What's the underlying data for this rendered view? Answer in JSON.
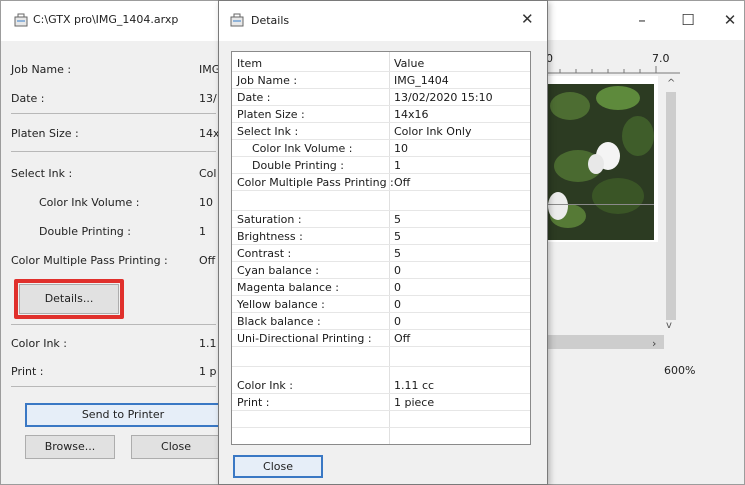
{
  "main_window": {
    "title": "C:\\GTX pro\\IMG_1404.arxp",
    "controls": {
      "minimize": "–",
      "maximize": "☐",
      "close": "✕"
    },
    "fields": [
      {
        "label": "Job Name :",
        "value": "IMG"
      },
      {
        "label": "Date :",
        "value": "13/"
      },
      {
        "label": "Platen Size :",
        "value": "14x"
      },
      {
        "label": "Select Ink :",
        "value": "Col"
      },
      {
        "label": "Color Ink Volume :",
        "value": "10"
      },
      {
        "label": "Double Printing :",
        "value": "1"
      },
      {
        "label": "Color Multiple Pass Printing :",
        "value": "Off"
      },
      {
        "label": "Color Ink :",
        "value": "1.1"
      },
      {
        "label": "Print :",
        "value": "1 p"
      }
    ],
    "details_button": "Details...",
    "send_button": "Send to Printer",
    "browse_button": "Browse...",
    "close_button": "Close",
    "ruler_labels": [
      "0",
      "7.0"
    ],
    "zoom": "600%"
  },
  "dialog": {
    "title": "Details",
    "close_x": "✕",
    "headers": {
      "item": "Item",
      "value": "Value"
    },
    "rows": [
      {
        "item": "Job Name :",
        "value": "IMG_1404"
      },
      {
        "item": "Date :",
        "value": "13/02/2020 15:10"
      },
      {
        "item": "Platen Size :",
        "value": "14x16"
      },
      {
        "item": "Select Ink :",
        "value": "Color Ink Only"
      },
      {
        "item": "Color Ink Volume :",
        "value": "10"
      },
      {
        "item": "Double Printing :",
        "value": "1"
      },
      {
        "item": "Color Multiple Pass Printing :",
        "value": "Off"
      },
      {
        "item": "",
        "value": ""
      },
      {
        "item": "Saturation :",
        "value": "5"
      },
      {
        "item": "Brightness :",
        "value": "5"
      },
      {
        "item": "Contrast :",
        "value": "5"
      },
      {
        "item": "Cyan balance :",
        "value": "0"
      },
      {
        "item": "Magenta balance :",
        "value": "0"
      },
      {
        "item": "Yellow balance :",
        "value": "0"
      },
      {
        "item": "Black balance :",
        "value": "0"
      },
      {
        "item": "Uni-Directional Printing :",
        "value": "Off"
      },
      {
        "item": "",
        "value": ""
      },
      {
        "item": "Color Ink :",
        "value": "1.11 cc"
      },
      {
        "item": "Print :",
        "value": "1 piece"
      }
    ],
    "close_button": "Close"
  },
  "colors": {
    "highlight": "#e0302c",
    "focus_border": "#3a78c4"
  }
}
